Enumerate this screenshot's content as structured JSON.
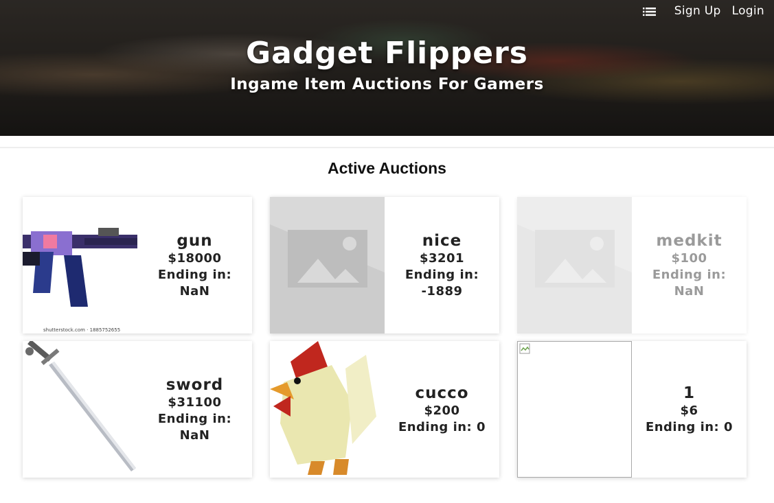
{
  "nav": {
    "menu_icon": "list-icon",
    "signup_label": "Sign Up",
    "login_label": "Login"
  },
  "hero": {
    "title": "Gadget Flippers",
    "subtitle": "Ingame Item Auctions For Gamers"
  },
  "main": {
    "section_title": "Active Auctions"
  },
  "auctions": [
    {
      "name": "gun",
      "price": "$18000",
      "ending": "Ending in: NaN",
      "image": "rifle-image",
      "watermark": "shutterstock.com · 1885752655"
    },
    {
      "name": "nice",
      "price": "$3201",
      "ending": "Ending in: -1889",
      "image": "placeholder-image"
    },
    {
      "name": "medkit",
      "price": "$100",
      "ending": "Ending in: NaN",
      "image": "placeholder-image"
    },
    {
      "name": "sword",
      "price": "$31100",
      "ending": "Ending in: NaN",
      "image": "sword-image"
    },
    {
      "name": "cucco",
      "price": "$200",
      "ending": "Ending in: 0",
      "image": "chicken-image"
    },
    {
      "name": "1",
      "price": "$6",
      "ending": "Ending in: 0",
      "image": "broken-image-icon"
    }
  ],
  "colors": {
    "text": "#222222",
    "card_shadow": "#d0d0d0",
    "placeholder": "#d9d9d9"
  }
}
